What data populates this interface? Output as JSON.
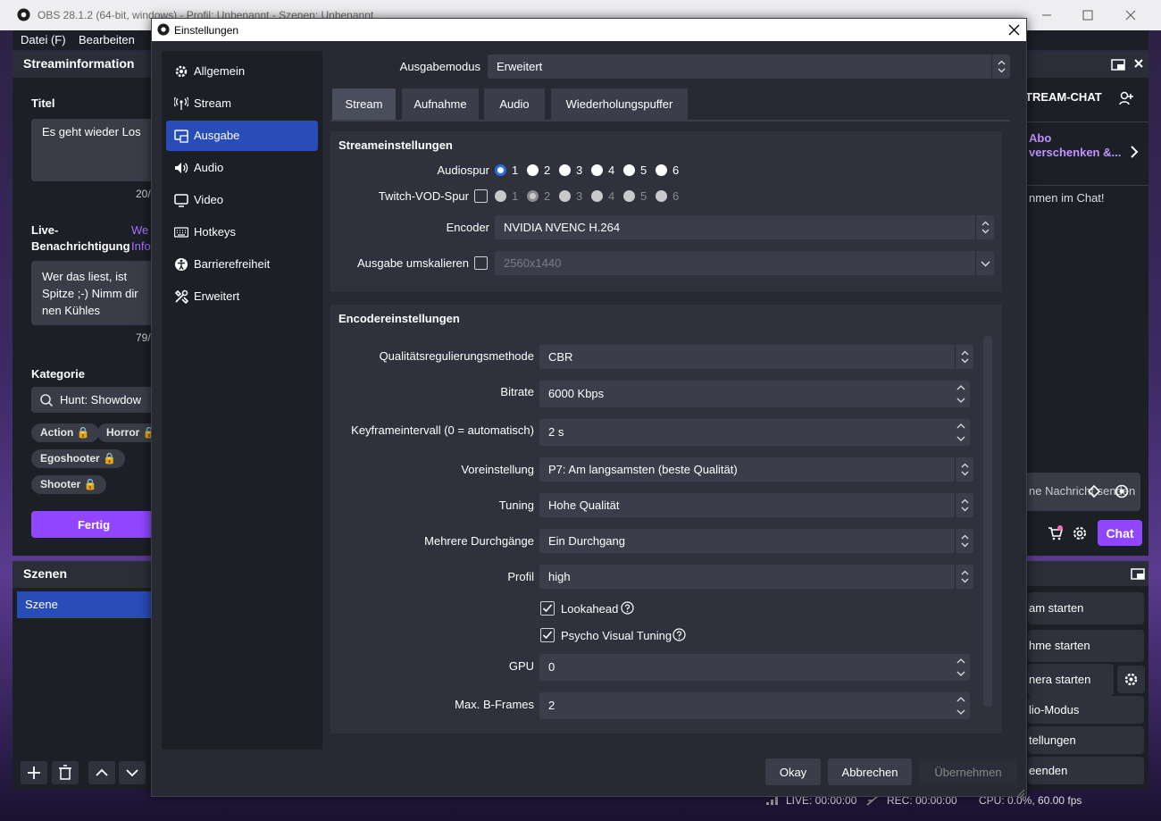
{
  "window": {
    "title": "OBS 28.1.2 (64-bit, windows) - Profil: Unbenannt - Szenen: Unbenannt"
  },
  "menu": {
    "file": "Datei (F)",
    "edit": "Bearbeiten"
  },
  "streaminfo": {
    "header": "Streaminformation",
    "title_label": "Titel",
    "title_value": "Es geht wieder Los",
    "title_count": "20/",
    "live_label": "Live-Benachrichtigung",
    "live_link": "We Info",
    "live_value": "Wer das liest, ist Spitze ;-) Nimm dir nen Kühles",
    "live_count": "79/",
    "category_label": "Kategorie",
    "category_value": "Hunt: Showdow",
    "tags": [
      "Action",
      "Horror",
      "Egoshooter",
      "Shooter"
    ],
    "done_button": "Fertig"
  },
  "scenes": {
    "header": "Szenen",
    "items": [
      "Szene"
    ]
  },
  "chat": {
    "header": "TREAM-CHAT",
    "abo_line1": "Abo",
    "abo_line2": "verschenken &...",
    "welcome": "nmen im Chat!",
    "input_placeholder": "ne Nachricht senden",
    "chat_button": "Chat"
  },
  "controls": {
    "items": [
      "am starten",
      "hme starten",
      "nera starten",
      "lio-Modus",
      "tellungen",
      "eenden"
    ]
  },
  "status": {
    "live": "LIVE: 00:00:00",
    "rec": "REC: 00:00:00",
    "cpu": "CPU: 0.0%, 60.00 fps"
  },
  "dialog": {
    "title": "Einstellungen",
    "nav": [
      {
        "label": "Allgemein",
        "icon": "gear-icon"
      },
      {
        "label": "Stream",
        "icon": "antenna-icon"
      },
      {
        "label": "Ausgabe",
        "icon": "output-icon"
      },
      {
        "label": "Audio",
        "icon": "speaker-icon"
      },
      {
        "label": "Video",
        "icon": "monitor-icon"
      },
      {
        "label": "Hotkeys",
        "icon": "keyboard-icon"
      },
      {
        "label": "Barrierefreiheit",
        "icon": "accessibility-icon"
      },
      {
        "label": "Erweitert",
        "icon": "tools-icon"
      }
    ],
    "output_mode_label": "Ausgabemodus",
    "output_mode_value": "Erweitert",
    "tabs": [
      "Stream",
      "Aufnahme",
      "Audio",
      "Wiederholungspuffer"
    ],
    "stream_settings": {
      "header": "Streameinstellungen",
      "audio_track_label": "Audiospur",
      "audio_tracks": [
        "1",
        "2",
        "3",
        "4",
        "5",
        "6"
      ],
      "audio_track_selected": "1",
      "vod_label": "Twitch-VOD-Spur",
      "encoder_label": "Encoder",
      "encoder_value": "NVIDIA NVENC H.264",
      "rescale_label": "Ausgabe umskalieren",
      "rescale_value": "2560x1440"
    },
    "encoder_settings": {
      "header": "Encodereinstellungen",
      "rate_control_label": "Qualitätsregulierungsmethode",
      "rate_control_value": "CBR",
      "bitrate_label": "Bitrate",
      "bitrate_value": "6000 Kbps",
      "keyframe_label": "Keyframeintervall (0 = automatisch)",
      "keyframe_value": "2 s",
      "preset_label": "Voreinstellung",
      "preset_value": "P7: Am langsamsten (beste Qualität)",
      "tuning_label": "Tuning",
      "tuning_value": "Hohe Qualität",
      "multipass_label": "Mehrere Durchgänge",
      "multipass_value": "Ein Durchgang",
      "profile_label": "Profil",
      "profile_value": "high",
      "lookahead_label": "Lookahead",
      "psycho_label": "Psycho Visual Tuning",
      "gpu_label": "GPU",
      "gpu_value": "0",
      "bframes_label": "Max. B-Frames",
      "bframes_value": "2"
    },
    "buttons": {
      "ok": "Okay",
      "cancel": "Abbrechen",
      "apply": "Übernehmen"
    }
  }
}
